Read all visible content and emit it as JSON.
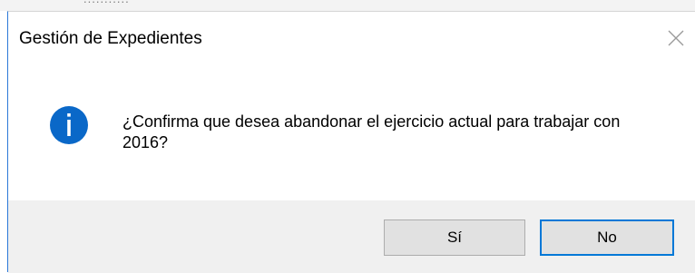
{
  "dialog": {
    "title": "Gestión de Expedientes",
    "message": "¿Confirma que desea abandonar el ejercicio actual para trabajar con 2016?",
    "icon": "info-icon",
    "buttons": {
      "yes_label": "Sí",
      "no_label": "No"
    },
    "default_button": "No"
  },
  "background": {
    "partial_text": "..........."
  },
  "colors": {
    "accent": "#0078d7",
    "info_icon": "#0a68c8",
    "footer_bg": "#f0f0f0",
    "button_bg": "#e1e1e1"
  }
}
